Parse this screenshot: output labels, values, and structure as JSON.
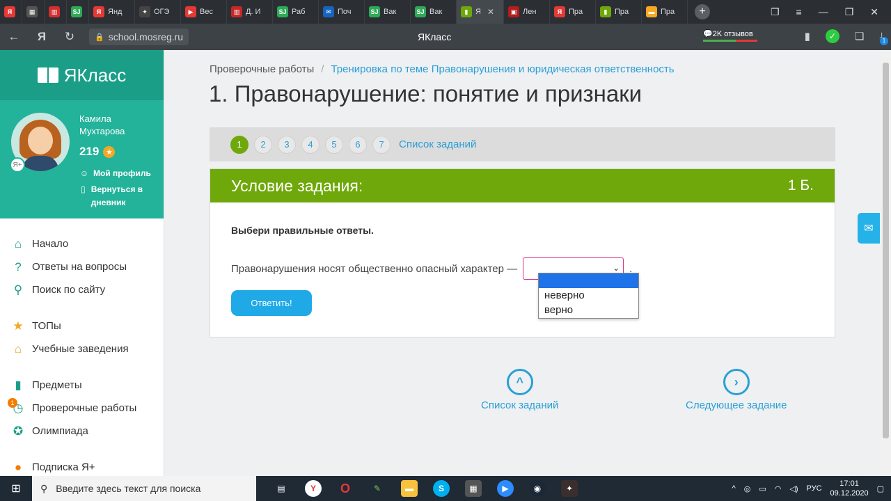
{
  "browser": {
    "tabs": [
      {
        "icon": "Я",
        "icon_color": "#e53935",
        "label": ""
      },
      {
        "icon": "▦",
        "icon_color": "#555555",
        "label": ""
      },
      {
        "icon": "▥",
        "icon_color": "#d32f2f",
        "label": ""
      },
      {
        "icon": "SJ",
        "icon_color": "#2eaa58",
        "label": ""
      },
      {
        "icon": "Я",
        "icon_color": "#e53935",
        "label": "Янд"
      },
      {
        "icon": "✦",
        "icon_color": "#444444",
        "label": "ОГЭ"
      },
      {
        "icon": "▶",
        "icon_color": "#e53935",
        "label": "Вес"
      },
      {
        "icon": "▥",
        "icon_color": "#c62828",
        "label": "Д. И"
      },
      {
        "icon": "SJ",
        "icon_color": "#2eaa58",
        "label": "Раб"
      },
      {
        "icon": "✉",
        "icon_color": "#1565c0",
        "label": "Поч"
      },
      {
        "icon": "SJ",
        "icon_color": "#2eaa58",
        "label": "Вак"
      },
      {
        "icon": "SJ",
        "icon_color": "#2eaa58",
        "label": "Вак"
      },
      {
        "icon": "▮",
        "icon_color": "#6fa80a",
        "label": "Я",
        "active": true
      },
      {
        "icon": "▣",
        "icon_color": "#b71c1c",
        "label": "Лен"
      },
      {
        "icon": "Я",
        "icon_color": "#e53935",
        "label": "Пра"
      },
      {
        "icon": "▮",
        "icon_color": "#6fa80a",
        "label": "Пра"
      },
      {
        "icon": "▬",
        "icon_color": "#f9a825",
        "label": "Пра"
      }
    ],
    "url": "school.mosreg.ru",
    "page_title": "ЯКласс",
    "reviews_label": "2K отзывов",
    "notif_count": "1"
  },
  "sidebar": {
    "logo_text": "ЯКласс",
    "user_name": "Камила Мухтарова",
    "points": "219",
    "my_profile": "Мой профиль",
    "back_to_diary": "Вернуться в дневник",
    "menu": [
      {
        "label": "Начало",
        "icon": "⌂",
        "color": "#1a9e88",
        "name": "home"
      },
      {
        "label": "Ответы на вопросы",
        "icon": "?",
        "color": "#1a9e88",
        "name": "answers"
      },
      {
        "label": "Поиск по сайту",
        "icon": "⚲",
        "color": "#1a9e88",
        "name": "search"
      },
      {
        "label": "ТОПы",
        "icon": "★",
        "color": "#f5a623",
        "name": "tops"
      },
      {
        "label": "Учебные заведения",
        "icon": "⌂",
        "color": "#f5a623",
        "name": "institutions"
      },
      {
        "label": "Предметы",
        "icon": "▮",
        "color": "#1a9e88",
        "name": "subjects"
      },
      {
        "label": "Проверочные работы",
        "icon": "◷",
        "color": "#1a9e88",
        "name": "tests",
        "badge": "1"
      },
      {
        "label": "Олимпиада",
        "icon": "✪",
        "color": "#1a9e88",
        "name": "olympiad"
      },
      {
        "label": "Подписка Я+",
        "icon": "●",
        "color": "#f57c00",
        "name": "subscription"
      }
    ]
  },
  "main": {
    "breadcrumb_root": "Проверочные работы",
    "breadcrumb_sep": "/",
    "breadcrumb_current": "Тренировка по теме Правонарушения и юридическая ответственность",
    "title": "1. Правонарушение: понятие и признаки",
    "pages": [
      "1",
      "2",
      "3",
      "4",
      "5",
      "6",
      "7"
    ],
    "current_page": "1",
    "task_list_link": "Список заданий",
    "card_title": "Условие задания:",
    "card_points": "1 Б.",
    "instruction": "Выбери правильные ответы.",
    "question_text": "Правонарушения носят общественно опасный характер —",
    "question_end": ".",
    "answer_button": "Ответить!",
    "dropdown_options": [
      "",
      "неверно",
      "верно"
    ],
    "nav_task_list": "Список заданий",
    "nav_next": "Следующее задание"
  },
  "taskbar": {
    "search_placeholder": "Введите здесь текст для поиска",
    "lang": "РУС",
    "time": "17:01",
    "date": "09.12.2020"
  }
}
